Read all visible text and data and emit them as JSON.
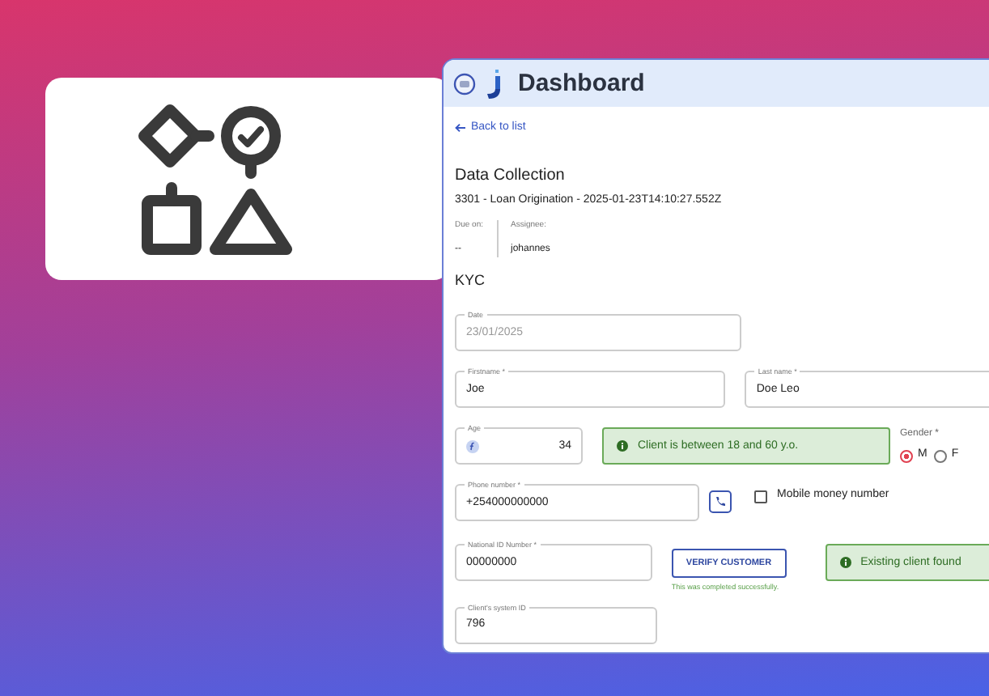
{
  "header": {
    "title": "Dashboard"
  },
  "back_link": "Back to list",
  "page_title": "Data Collection",
  "subtitle": "3301 - Loan Origination - 2025-01-23T14:10:27.552Z",
  "meta": [
    {
      "label": "Due on:",
      "value": "--"
    },
    {
      "label": "Assignee:",
      "value": "johannes"
    }
  ],
  "section": "KYC",
  "date": {
    "label": "Date",
    "value": "23/01/2025",
    "disabled": true
  },
  "firstname": {
    "label": "Firstname *",
    "value": "Joe"
  },
  "lastname": {
    "label": "Last name *",
    "value": "Doe Leo"
  },
  "age": {
    "label": "Age",
    "value": "34"
  },
  "age_alert": "Client is between 18 and 60 y.o.",
  "gender": {
    "label": "Gender *",
    "options": [
      {
        "label": "M",
        "selected": true
      },
      {
        "label": "F",
        "selected": false
      }
    ]
  },
  "phone": {
    "label": "Phone number *",
    "value": "+254000000000"
  },
  "mobile_money": {
    "label": "Mobile money number",
    "checked": false
  },
  "national_id": {
    "label": "National ID Number *",
    "value": "00000000"
  },
  "verify_button": "VERIFY CUSTOMER",
  "verify_note": "This was completed successfully.",
  "verify_alert": "Existing client found",
  "system_id": {
    "label": "Client's system ID",
    "value": "796"
  }
}
